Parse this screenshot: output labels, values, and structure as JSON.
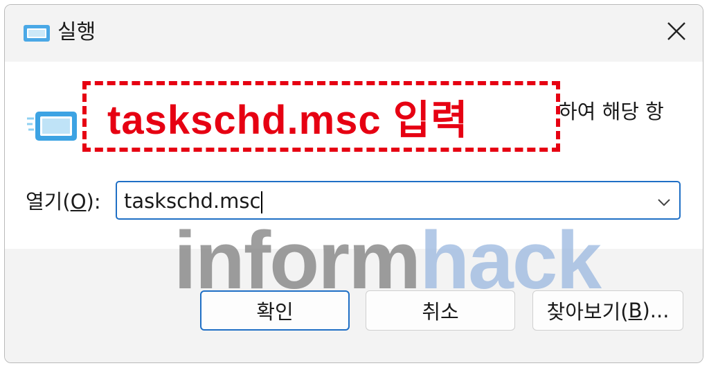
{
  "window": {
    "title": "실행",
    "title_icon": "run-dialog-icon",
    "close_icon": "close-icon"
  },
  "content": {
    "description_visible_fragment": "하여 해당 항",
    "annotation_text": "taskschd.msc 입력"
  },
  "open_field": {
    "label_prefix": "열기(",
    "label_accel": "O",
    "label_suffix": "):",
    "value": "taskschd.msc",
    "dropdown_icon": "chevron-down-icon"
  },
  "watermark": {
    "part1": "inform",
    "part2": "hack"
  },
  "buttons": {
    "ok_label": "확인",
    "cancel_label": "취소",
    "browse_prefix": "찾아보기(",
    "browse_accel": "B",
    "browse_suffix": ")..."
  },
  "colors": {
    "annotation_red": "#e60012",
    "focus_blue": "#1f6fc5",
    "watermark_gray": "#7e7e7e",
    "watermark_blue": "#9ab8e0",
    "titlebar_bg": "#f3f3f3"
  }
}
